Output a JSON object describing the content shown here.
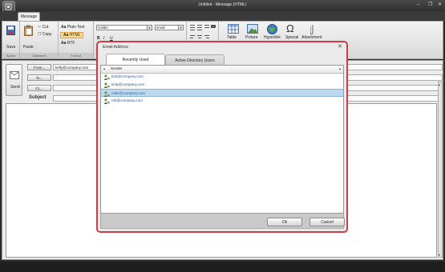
{
  "window": {
    "title": "Untitled - Message (HTML)",
    "minimize": "–",
    "restore": "❐",
    "close": "✕"
  },
  "ribbon": {
    "tab": "Message",
    "actions": {
      "save": "Save",
      "label": "Action"
    },
    "clipboard": {
      "paste": "Paste",
      "cut": "Cut",
      "copy": "Copy",
      "label": "Clipboard"
    },
    "format": {
      "plain_text": "Plain Text",
      "html": "HTML",
      "rtf": "RTF",
      "label": "Format"
    },
    "font": {
      "family": "Calibri",
      "size": "small"
    },
    "insert": {
      "table": "Table",
      "picture": "Picture",
      "hyperlink": "Hyperlink",
      "special": "Special",
      "attachment": "Attachment"
    }
  },
  "compose": {
    "send": "Send",
    "from_label": "From...",
    "from_value": "kelly@company.com",
    "to_label": "To...",
    "cc_label": "Cc...",
    "subject_label": "Subject"
  },
  "dialog": {
    "title": "Email Address",
    "close": "✕",
    "tabs": [
      "Recently Used",
      "Active Directory Users"
    ],
    "column": "Sender",
    "rows": [
      "bob@company.com",
      "kelly@company.com",
      "mike@company.com",
      "rob@company.com"
    ],
    "selected_row": 2,
    "ok": "Ok",
    "cancel": "Cancel"
  },
  "colors": {
    "accent": "#d33a45",
    "selection": "#bcd8f0",
    "link": "#2a5a9a"
  }
}
